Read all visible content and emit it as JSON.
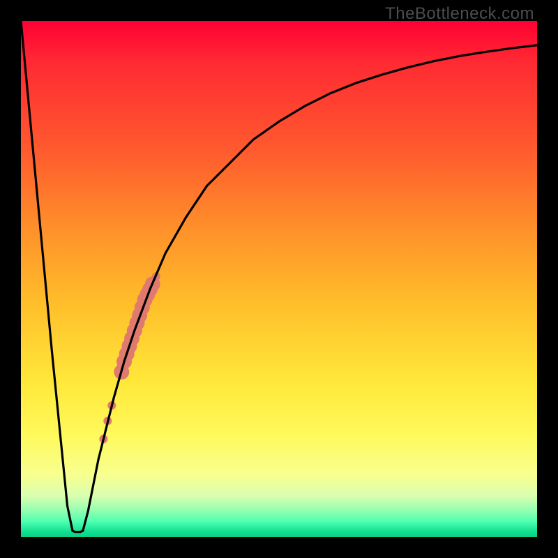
{
  "watermark": {
    "text": "TheBottleneck.com"
  },
  "chart_data": {
    "type": "line",
    "title": "",
    "xlabel": "",
    "ylabel": "",
    "xlim": [
      0,
      100
    ],
    "ylim": [
      0,
      100
    ],
    "grid": false,
    "series": [
      {
        "name": "bottleneck-curve",
        "color": "#000000",
        "x": [
          0,
          3,
          6,
          9,
          10,
          10.5,
          11,
          11.5,
          12,
          13,
          14,
          15,
          16,
          18,
          20,
          22,
          25,
          28,
          32,
          36,
          40,
          45,
          50,
          55,
          60,
          65,
          70,
          75,
          80,
          85,
          90,
          95,
          100
        ],
        "values": [
          100,
          68,
          36,
          6,
          1.2,
          1.0,
          1.0,
          1.0,
          1.2,
          5,
          10,
          15,
          19,
          27,
          34,
          40,
          48,
          55,
          62,
          68,
          72,
          77,
          80.5,
          83.5,
          86,
          88,
          89.6,
          91,
          92.2,
          93.2,
          94,
          94.7,
          95.3
        ]
      }
    ],
    "markers": {
      "name": "highlighted-range",
      "color": "#e07a6e",
      "points": [
        {
          "x": 16.0,
          "y": 19.0,
          "r": 6
        },
        {
          "x": 16.8,
          "y": 22.5,
          "r": 6
        },
        {
          "x": 17.6,
          "y": 25.5,
          "r": 6
        },
        {
          "x": 19.5,
          "y": 32.0,
          "r": 11
        },
        {
          "x": 20.0,
          "y": 34.0,
          "r": 11
        },
        {
          "x": 20.5,
          "y": 35.5,
          "r": 11
        },
        {
          "x": 21.0,
          "y": 37.0,
          "r": 11
        },
        {
          "x": 21.5,
          "y": 38.5,
          "r": 11
        },
        {
          "x": 22.0,
          "y": 40.0,
          "r": 11
        },
        {
          "x": 22.5,
          "y": 41.5,
          "r": 11
        },
        {
          "x": 23.0,
          "y": 43.0,
          "r": 11
        },
        {
          "x": 23.5,
          "y": 44.5,
          "r": 11
        },
        {
          "x": 24.0,
          "y": 46.0,
          "r": 11
        },
        {
          "x": 24.5,
          "y": 47.0,
          "r": 11
        },
        {
          "x": 25.0,
          "y": 48.0,
          "r": 11
        },
        {
          "x": 25.5,
          "y": 49.0,
          "r": 11
        },
        {
          "x": 26.2,
          "y": 50.5,
          "r": 6
        }
      ]
    },
    "background_gradient": {
      "top": "#ff0033",
      "upper_mid": "#ffbf2a",
      "lower_mid": "#fff95a",
      "bottom": "#0ccf85"
    }
  }
}
